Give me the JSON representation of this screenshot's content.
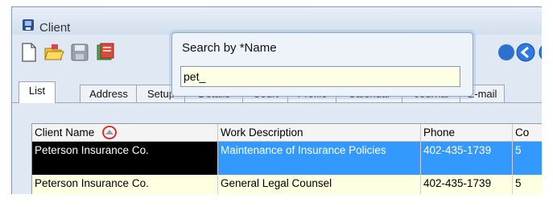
{
  "window": {
    "title": "Client"
  },
  "search_popup": {
    "label": "Search by *Name",
    "value": "pet_"
  },
  "tabs": [
    {
      "label": "List"
    },
    {
      "label": "Address"
    },
    {
      "label": "Setup"
    },
    {
      "label": "Details"
    },
    {
      "label": "Court"
    },
    {
      "label": "Profile"
    },
    {
      "label": "Calendar"
    },
    {
      "label": "Journal"
    },
    {
      "label": "E-mail"
    }
  ],
  "grid": {
    "columns": [
      "Client Name",
      "Work Description",
      "Phone",
      "Co"
    ],
    "rows": [
      {
        "client": "Peterson Insurance Co.",
        "work": "Maintenance of Insurance Policies",
        "phone": "402-435-1739",
        "extra": "5"
      },
      {
        "client": "Peterson Insurance Co.",
        "work": "General Legal Counsel",
        "phone": "402-435-1739",
        "extra": "5"
      }
    ]
  },
  "colors": {
    "selected_row": "#3399ff",
    "highlight_yellow": "#ffffe1",
    "sort_marker": "#e02020"
  },
  "icons": [
    "app-icon",
    "new-icon",
    "open-folder-icon",
    "save-icon",
    "notes-icon",
    "nav-blue-icon",
    "back-arrow-icon",
    "forward-arrow-icon",
    "sort-indicator-icon"
  ]
}
